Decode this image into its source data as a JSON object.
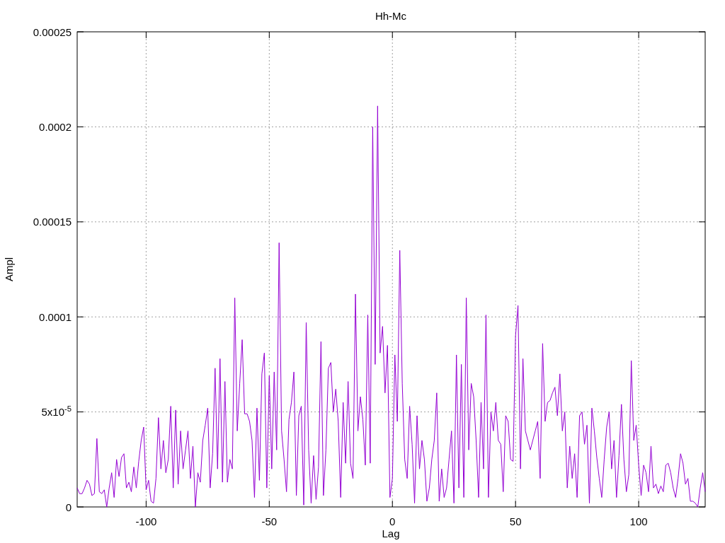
{
  "chart_data": {
    "type": "line",
    "title": "Hh-Mc",
    "xlabel": "Lag",
    "ylabel": "Ampl",
    "grid": true,
    "xlim": [
      -128,
      127
    ],
    "ylim": [
      0,
      0.00025
    ],
    "xticks": [
      -100,
      -50,
      0,
      50,
      100
    ],
    "yticks": [
      {
        "value": 0,
        "label": "0"
      },
      {
        "value": 5e-05,
        "label": "5x10$^{-5}$"
      },
      {
        "value": 0.0001,
        "label": "0.0001"
      },
      {
        "value": 0.00015,
        "label": "0.00015"
      },
      {
        "value": 0.0002,
        "label": "0.0002"
      },
      {
        "value": 0.00025,
        "label": "0.00025"
      }
    ],
    "x": [
      -128,
      -127,
      -126,
      -125,
      -124,
      -123,
      -122,
      -121,
      -120,
      -119,
      -118,
      -117,
      -116,
      -115,
      -114,
      -113,
      -112,
      -111,
      -110,
      -109,
      -108,
      -107,
      -106,
      -105,
      -104,
      -103,
      -102,
      -101,
      -100,
      -99,
      -98,
      -97,
      -96,
      -95,
      -94,
      -93,
      -92,
      -91,
      -90,
      -89,
      -88,
      -87,
      -86,
      -85,
      -84,
      -83,
      -82,
      -81,
      -80,
      -79,
      -78,
      -77,
      -76,
      -75,
      -74,
      -73,
      -72,
      -71,
      -70,
      -69,
      -68,
      -67,
      -66,
      -65,
      -64,
      -63,
      -62,
      -61,
      -60,
      -59,
      -58,
      -57,
      -56,
      -55,
      -54,
      -53,
      -52,
      -51,
      -50,
      -49,
      -48,
      -47,
      -46,
      -45,
      -44,
      -43,
      -42,
      -41,
      -40,
      -39,
      -38,
      -37,
      -36,
      -35,
      -34,
      -33,
      -32,
      -31,
      -30,
      -29,
      -28,
      -27,
      -26,
      -25,
      -24,
      -23,
      -22,
      -21,
      -20,
      -19,
      -18,
      -17,
      -16,
      -15,
      -14,
      -13,
      -12,
      -11,
      -10,
      -9,
      -8,
      -7,
      -6,
      -5,
      -4,
      -3,
      -2,
      -1,
      0,
      1,
      2,
      3,
      4,
      5,
      6,
      7,
      8,
      9,
      10,
      11,
      12,
      13,
      14,
      15,
      16,
      17,
      18,
      19,
      20,
      21,
      22,
      23,
      24,
      25,
      26,
      27,
      28,
      29,
      30,
      31,
      32,
      33,
      34,
      35,
      36,
      37,
      38,
      39,
      40,
      41,
      42,
      43,
      44,
      45,
      46,
      47,
      48,
      49,
      50,
      51,
      52,
      53,
      54,
      55,
      56,
      57,
      58,
      59,
      60,
      61,
      62,
      63,
      64,
      65,
      66,
      67,
      68,
      69,
      70,
      71,
      72,
      73,
      74,
      75,
      76,
      77,
      78,
      79,
      80,
      81,
      82,
      83,
      84,
      85,
      86,
      87,
      88,
      89,
      90,
      91,
      92,
      93,
      94,
      95,
      96,
      97,
      98,
      99,
      100,
      101,
      102,
      103,
      104,
      105,
      106,
      107,
      108,
      109,
      110,
      111,
      112,
      113,
      114,
      115,
      116,
      117,
      118,
      119,
      120,
      121,
      122,
      123,
      124,
      125,
      126,
      127
    ],
    "series": [
      {
        "color": "#9400d3",
        "values": [
          1e-05,
          7e-06,
          7e-06,
          1e-05,
          1.4e-05,
          1.2e-05,
          6e-06,
          7e-06,
          3.6e-05,
          8e-06,
          7e-06,
          9e-06,
          0,
          1e-05,
          1.8e-05,
          5e-06,
          2.5e-05,
          1.6e-05,
          2.6e-05,
          2.8e-05,
          1e-05,
          1.3e-05,
          8e-06,
          2.1e-05,
          1e-05,
          2.4e-05,
          3.5e-05,
          4.2e-05,
          9e-06,
          1.4e-05,
          3e-06,
          2e-06,
          1.5e-05,
          4.7e-05,
          2e-05,
          3.5e-05,
          1.8e-05,
          2.5e-05,
          5.3e-05,
          1e-05,
          5.1e-05,
          1.2e-05,
          4e-05,
          2e-05,
          3e-05,
          4e-05,
          1.5e-05,
          3.2e-05,
          0,
          1.8e-05,
          1.3e-05,
          3.5e-05,
          4.3e-05,
          5.2e-05,
          1e-05,
          2.8e-05,
          7.3e-05,
          2e-05,
          7.8e-05,
          1.3e-05,
          6.6e-05,
          1.3e-05,
          2.5e-05,
          2e-05,
          0.00011,
          4e-05,
          6.5e-05,
          8.8e-05,
          4.9e-05,
          4.9e-05,
          4.5e-05,
          3.5e-05,
          5e-06,
          5.2e-05,
          1.4e-05,
          7e-05,
          8.1e-05,
          1e-05,
          6.9e-05,
          2e-05,
          7.1e-05,
          3e-05,
          0.000139,
          4e-05,
          2.5e-05,
          8e-06,
          4.6e-05,
          5.5e-05,
          7.1e-05,
          6e-06,
          4.8e-05,
          5.3e-05,
          1e-06,
          9.7e-05,
          3e-05,
          2e-06,
          2.7e-05,
          4e-06,
          2.1e-05,
          8.7e-05,
          6e-06,
          3e-05,
          7.3e-05,
          7.6e-05,
          5e-05,
          6.2e-05,
          4.5e-05,
          5e-06,
          5.5e-05,
          2.3e-05,
          6.6e-05,
          2.3e-05,
          1.5e-05,
          0.000112,
          4e-05,
          5.8e-05,
          4.6e-05,
          2.2e-05,
          0.000101,
          2.3e-05,
          0.0002,
          7.5e-05,
          0.000211,
          8.1e-05,
          9.5e-05,
          6e-05,
          8.5e-05,
          5e-06,
          1.5e-05,
          8e-05,
          4.5e-05,
          0.000135,
          6.5e-05,
          2.5e-05,
          1.5e-05,
          5.3e-05,
          3.3e-05,
          2e-06,
          4.8e-05,
          2e-05,
          3.5e-05,
          2.5e-05,
          3e-06,
          1e-05,
          2.5e-05,
          3.5e-05,
          6e-05,
          3e-06,
          2e-05,
          5e-06,
          1e-05,
          2.5e-05,
          4e-05,
          2e-06,
          8e-05,
          1e-05,
          7.5e-05,
          5e-06,
          0.00011,
          3e-05,
          6.5e-05,
          5.8e-05,
          3.5e-05,
          5e-06,
          5.5e-05,
          2e-05,
          0.000101,
          5e-06,
          5e-05,
          4e-05,
          5.5e-05,
          3.5e-05,
          3.3e-05,
          8e-06,
          4.8e-05,
          4.5e-05,
          2.5e-05,
          2.4e-05,
          9e-05,
          0.000106,
          2e-05,
          7.8e-05,
          4e-05,
          3.5e-05,
          3e-05,
          3.5e-05,
          4e-05,
          4.5e-05,
          1.5e-05,
          8.6e-05,
          4.5e-05,
          5.5e-05,
          5.6e-05,
          6e-05,
          6.3e-05,
          4.8e-05,
          7e-05,
          4e-05,
          5e-05,
          1e-05,
          3.2e-05,
          1.5e-05,
          2.8e-05,
          5e-06,
          4.8e-05,
          5e-05,
          3.3e-05,
          4.3e-05,
          2e-06,
          5.2e-05,
          4e-05,
          2.6e-05,
          1.5e-05,
          5e-06,
          2.5e-05,
          4.2e-05,
          5e-05,
          2e-05,
          3.5e-05,
          5e-06,
          2.7e-05,
          5.4e-05,
          2.5e-05,
          8e-06,
          1.7e-05,
          7.7e-05,
          3.5e-05,
          4.3e-05,
          2.2e-05,
          6e-06,
          2.2e-05,
          1.8e-05,
          8e-06,
          3.2e-05,
          1e-05,
          1.2e-05,
          7e-06,
          1.1e-05,
          8e-06,
          2.2e-05,
          2.3e-05,
          1.8e-05,
          1e-05,
          5e-06,
          1.5e-05,
          2.8e-05,
          2.3e-05,
          1.2e-05,
          1.5e-05,
          3e-06,
          3e-06,
          2e-06,
          0,
          1e-05,
          1.8e-05,
          8e-06
        ]
      }
    ]
  }
}
